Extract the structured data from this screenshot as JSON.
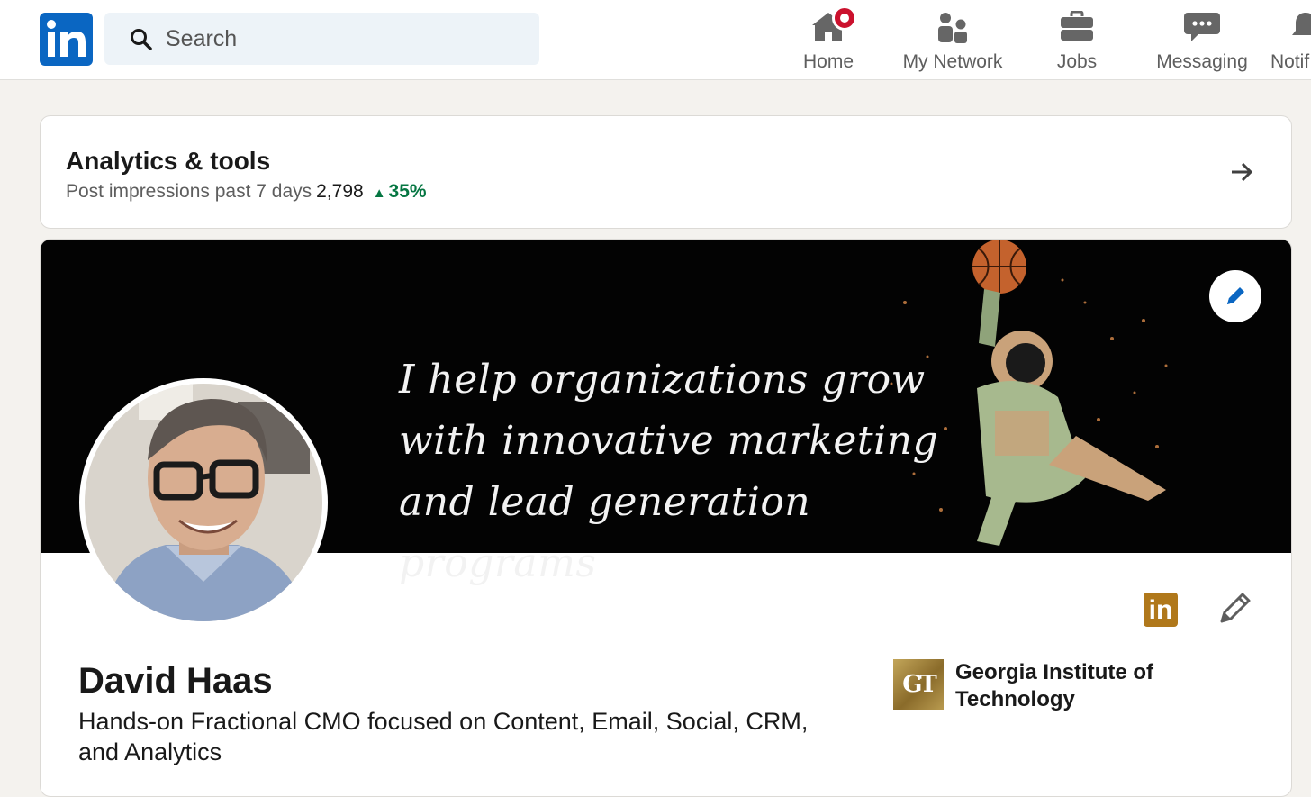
{
  "nav": {
    "logo_text": "in",
    "search_placeholder": "Search",
    "items": [
      {
        "label": "Home",
        "icon": "home-icon",
        "has_notification": true
      },
      {
        "label": "My Network",
        "icon": "my-network-icon"
      },
      {
        "label": "Jobs",
        "icon": "briefcase-icon"
      },
      {
        "label": "Messaging",
        "icon": "messaging-icon"
      },
      {
        "label": "Notif",
        "icon": "bell-icon"
      }
    ]
  },
  "analytics": {
    "title": "Analytics & tools",
    "impressions_label": "Post impressions past 7 days",
    "impressions_value": "2,798",
    "impressions_change": "35%",
    "change_direction": "up",
    "arrow_icon": "arrow-right-icon"
  },
  "profile": {
    "banner_lines": [
      "I help organizations grow",
      "with innovative marketing",
      "and lead generation programs"
    ],
    "name": "David Haas",
    "headline": "Hands-on Fractional CMO focused on Content, Email, Social, CRM, and Analytics",
    "premium_badge_text": "in",
    "education": {
      "logo_text": "GT",
      "school": "Georgia Institute of Technology"
    }
  },
  "colors": {
    "brand": "#0a66c2",
    "notification": "#cb112d",
    "positive": "#057642",
    "premium": "#b0781b",
    "page_bg": "#f4f2ee"
  }
}
